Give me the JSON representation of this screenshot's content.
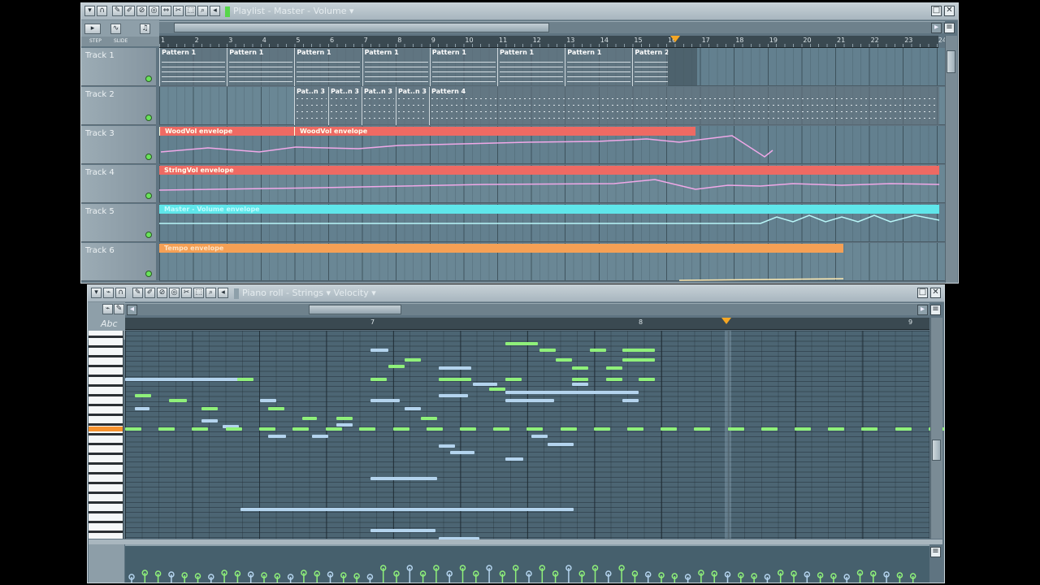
{
  "playlist": {
    "title": "Playlist - Master - Volume",
    "mode_labels": [
      "STEP",
      "SLIDE"
    ],
    "ruler_ticks": [
      "1",
      "2",
      "3",
      "4",
      "5",
      "6",
      "7",
      "8",
      "9",
      "10",
      "11",
      "12",
      "13",
      "14",
      "15",
      "16",
      "17",
      "18",
      "19",
      "20",
      "21",
      "22",
      "23",
      "24"
    ],
    "tracks": [
      {
        "name": "Track 1"
      },
      {
        "name": "Track 2"
      },
      {
        "name": "Track 3"
      },
      {
        "name": "Track 4"
      },
      {
        "name": "Track 5"
      },
      {
        "name": "Track 6"
      }
    ],
    "track1_clips": [
      "Pattern 1",
      "Pattern 1",
      "Pattern 1",
      "Pattern 1",
      "Pattern 1",
      "Pattern 1",
      "Pattern 1",
      "Pattern 2"
    ],
    "track2_clips": [
      "Pat..n 3",
      "Pat..n 3",
      "Pat..n 3",
      "Pat..n 3",
      "Pattern 4"
    ],
    "track3_clips": [
      "WoodVol envelope",
      "WoodVol envelope"
    ],
    "track4_clip": "StringVol envelope",
    "track5_clip": "Master - Volume envelope",
    "track6_clip": "Tempo envelope"
  },
  "pianoroll": {
    "title": "Piano roll - Strings",
    "target": "Velocity",
    "abc_label": "Abc",
    "ruler_ticks": [
      "7",
      "8",
      "9"
    ]
  },
  "colors": {
    "accent_green": "#57d64b",
    "note_green": "#8ff07a",
    "note_blue": "#b4d4ee",
    "env_red": "#ee6a63",
    "env_cyan": "#5fe6ea",
    "env_orange": "#f5a055",
    "marker_orange": "#f5a623"
  },
  "icons": {
    "close": "close-icon",
    "maximize": "maximize-icon",
    "menu": "menu-arrow-icon",
    "pencil": "pencil-icon",
    "brush": "brush-icon",
    "zoom": "zoom-icon",
    "play_marker": "song-position-marker-icon"
  }
}
